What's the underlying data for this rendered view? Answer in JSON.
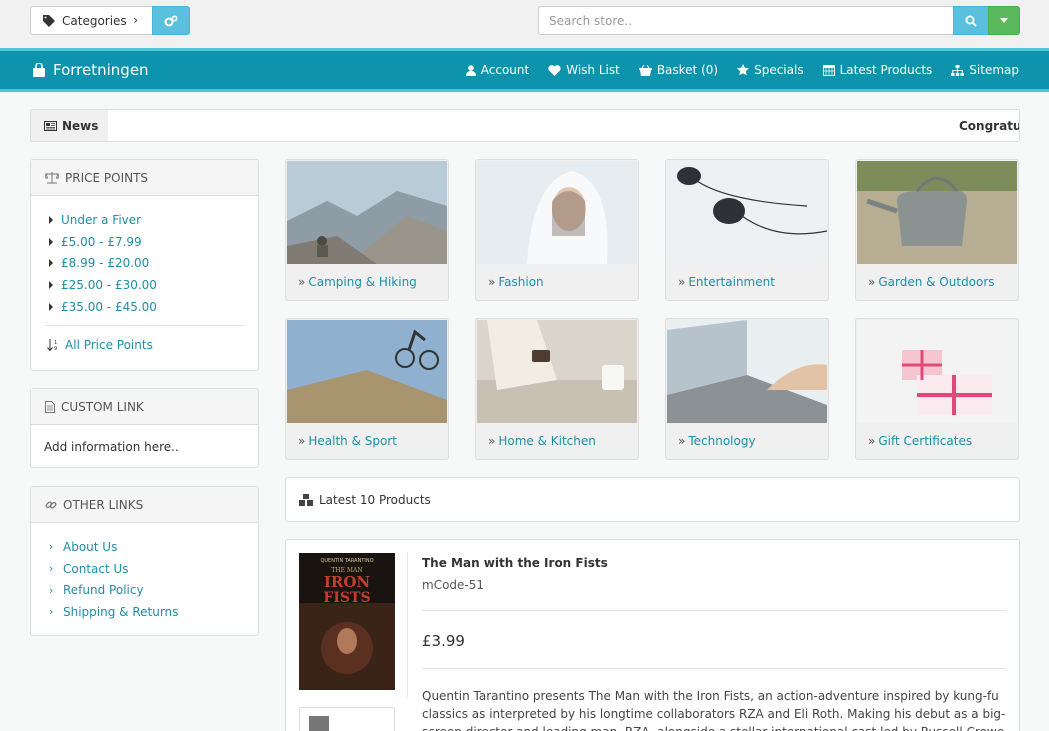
{
  "topbar": {
    "categories_label": "Categories",
    "search_placeholder": "Search store.."
  },
  "navbar": {
    "brand": "Forretningen",
    "links": [
      {
        "label": "Account",
        "icon": "user-icon"
      },
      {
        "label": "Wish List",
        "icon": "heart-icon"
      },
      {
        "label": "Basket (0)",
        "icon": "basket-icon"
      },
      {
        "label": "Specials",
        "icon": "star-icon"
      },
      {
        "label": "Latest Products",
        "icon": "calendar-icon"
      },
      {
        "label": "Sitemap",
        "icon": "sitemap-icon"
      }
    ]
  },
  "news": {
    "label": "News",
    "ticker": "Congratulations"
  },
  "price_points": {
    "title": "PRICE POINTS",
    "items": [
      "Under a Fiver",
      "£5.00 - £7.99",
      "£8.99 - £20.00",
      "£25.00 - £30.00",
      "£35.00 - £45.00"
    ],
    "all_label": "All Price Points"
  },
  "custom_link": {
    "title": "CUSTOM LINK",
    "body": "Add information here.."
  },
  "other_links": {
    "title": "OTHER LINKS",
    "items": [
      "About Us",
      "Contact Us",
      "Refund Policy",
      "Shipping & Returns"
    ]
  },
  "categories": [
    {
      "label": "Camping & Hiking",
      "image": "mountain-hiker"
    },
    {
      "label": "Fashion",
      "image": "woman-white-hood"
    },
    {
      "label": "Entertainment",
      "image": "earphones"
    },
    {
      "label": "Garden & Outdoors",
      "image": "watering-can"
    },
    {
      "label": "Health & Sport",
      "image": "mountain-biker"
    },
    {
      "label": "Home & Kitchen",
      "image": "coffee-table"
    },
    {
      "label": "Technology",
      "image": "laptop-typing"
    },
    {
      "label": "Gift Certificates",
      "image": "gift-boxes"
    }
  ],
  "latest": {
    "title": "Latest 10 Products"
  },
  "product": {
    "title": "The Man with the Iron Fists",
    "code": "mCode-51",
    "price": "£3.99",
    "description": "Quentin Tarantino presents The Man with the Iron Fists, an action-adventure inspired by kung-fu classics as interpreted by his longtime collaborators RZA and Eli Roth. Making his debut as a big-screen director and leading man, RZA, alongside a stellar international cast led by Russell Crowe and",
    "cover_text": {
      "top": "QUENTIN TARANTINO",
      "the_man": "THE MAN",
      "iron": "IRON",
      "fists": "FISTS"
    }
  },
  "colors": {
    "nav_bg": "#0d93ab",
    "nav_border": "#4ec6d6",
    "link": "#1f8ea6",
    "info_btn": "#5bc0de",
    "success_btn": "#5cb85c"
  }
}
